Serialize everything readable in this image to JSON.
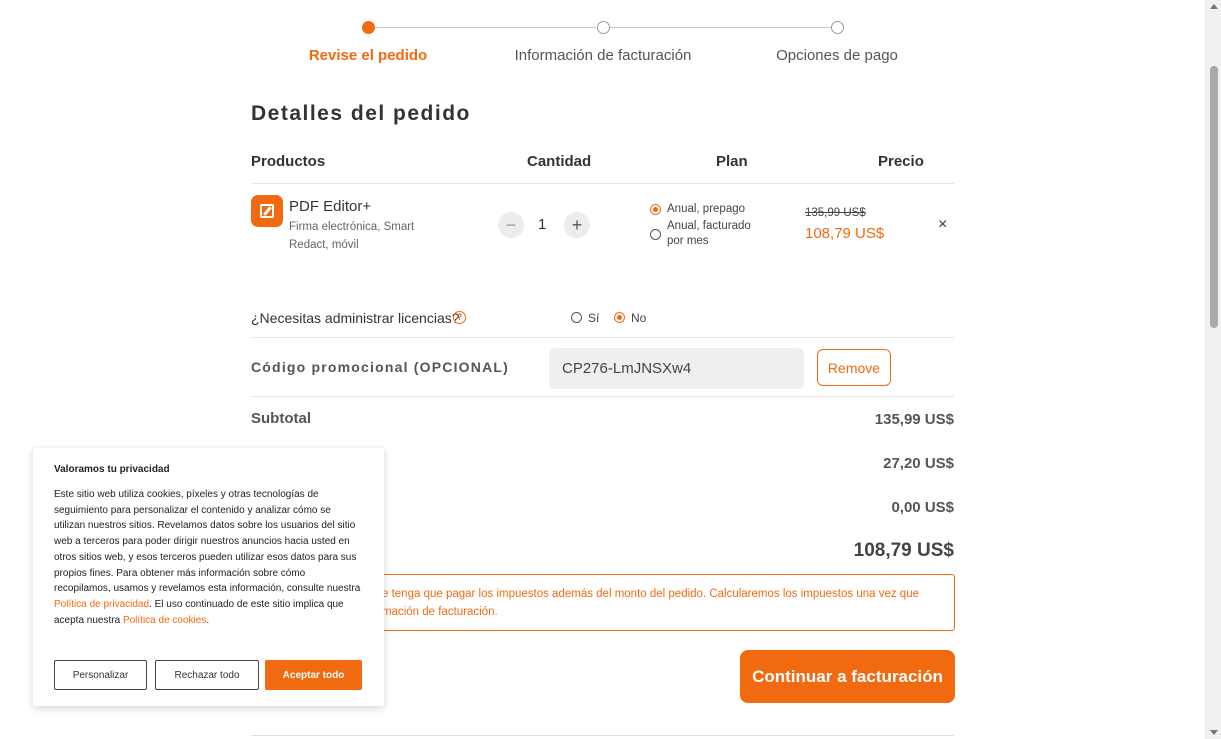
{
  "stepper": {
    "steps": [
      {
        "label": "Revise el pedido",
        "active": true
      },
      {
        "label": "Información de facturación",
        "active": false
      },
      {
        "label": "Opciones de pago",
        "active": false
      }
    ]
  },
  "order": {
    "title": "Detalles del pedido",
    "columns": {
      "products": "Productos",
      "quantity": "Cantidad",
      "plan": "Plan",
      "price": "Precio"
    },
    "item": {
      "name": "PDF Editor+",
      "description": "Firma electrónica, Smart Redact, móvil",
      "quantity": "1",
      "decrement": "−",
      "increment": "+",
      "plans": [
        {
          "label": "Anual, prepago",
          "selected": true
        },
        {
          "label": "Anual, facturado por mes",
          "selected": false
        }
      ],
      "price_original": "135,99 US$",
      "price_current": "108,79 US$",
      "remove": "×"
    }
  },
  "licenses": {
    "question": "¿Necesitas administrar licencias?",
    "help": "?",
    "options": [
      {
        "label": "Sí",
        "selected": false
      },
      {
        "label": "No",
        "selected": true
      }
    ]
  },
  "promo": {
    "label": "Código promocional (OPCIONAL)",
    "value": "CP276-LmJNSXw4",
    "remove_label": "Remove"
  },
  "summary": {
    "subtotal_label": "Subtotal",
    "subtotal": "135,99 US$",
    "discount": "27,20 US$",
    "tax": "0,00 US$",
    "total": "108,79 US$",
    "tax_note": "e tenga que pagar los impuestos además del monto del pedido. Calcularemos los impuestos una vez que",
    "tax_note_2": "mación de facturación.",
    "continue_label": "Continuar a facturación"
  },
  "cookie": {
    "title": "Valoramos tu privacidad",
    "text": "Este sitio web utiliza cookies, píxeles y otras tecnologías de seguimiento para personalizar el contenido y analizar cómo se utilizan nuestros sitios. Revelamos datos sobre los usuarios del sitio web a terceros para poder dirigir nuestros anuncios hacia usted en otros sitios web, y esos terceros pueden utilizar esos datos para sus propios fines. Para obtener más información sobre cómo recopilamos, usamos y revelamos esta información, consulte nuestra",
    "privacy_link": "Política de privacidad",
    "text_2": ". El uso continuado de este sitio implica que acepta nuestra",
    "cookie_link": "Política de cookies",
    "text_3": ".",
    "customize": "Personalizar",
    "reject": "Rechazar todo",
    "accept": "Aceptar todo"
  },
  "colors": {
    "accent": "#f26a10"
  }
}
